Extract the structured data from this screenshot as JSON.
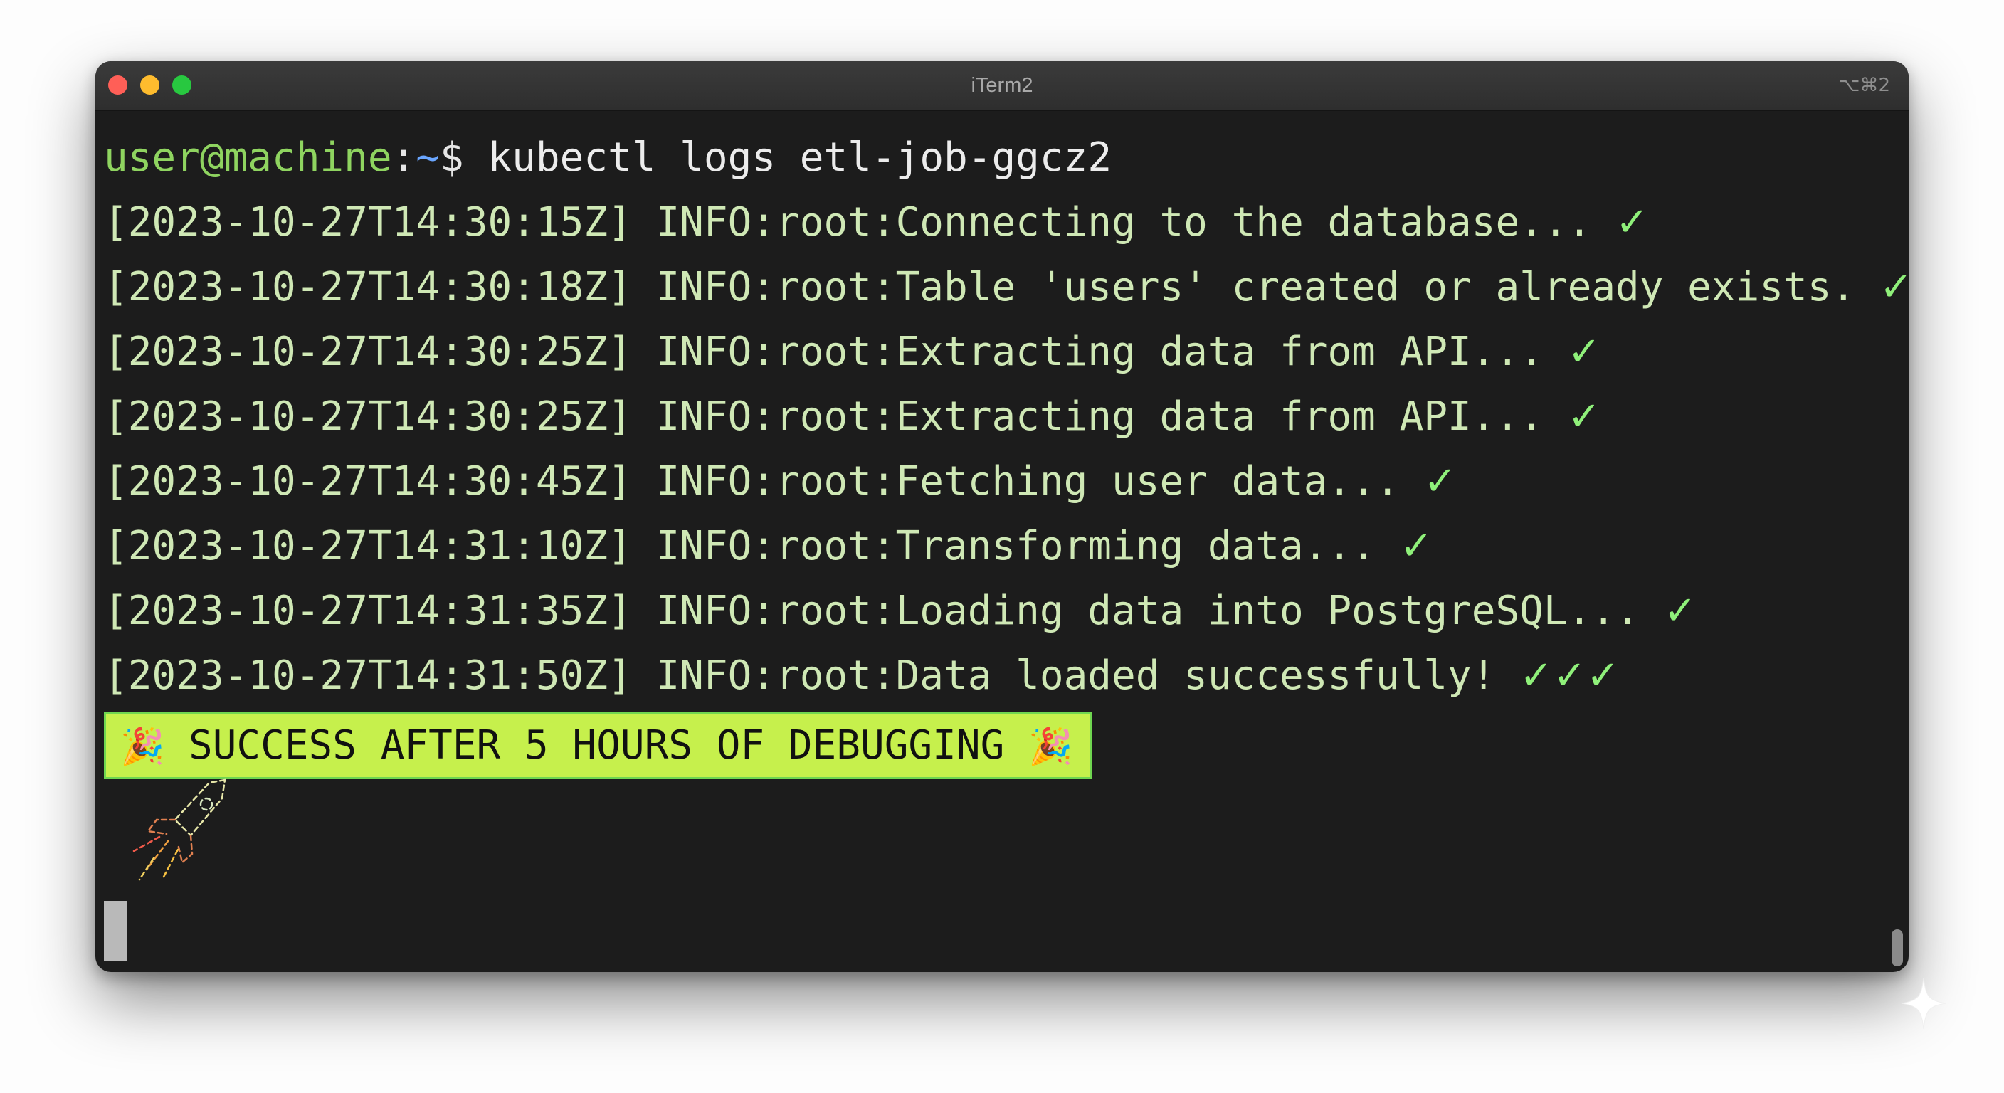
{
  "window": {
    "title": "iTerm2",
    "shortcut": "⌥⌘2"
  },
  "prompt": {
    "user_host": "user@machine",
    "separator": ":",
    "path": "~",
    "symbol": "$ ",
    "command": "kubectl logs etl-job-ggcz2"
  },
  "logs": [
    {
      "text": "[2023-10-27T14:30:15Z] INFO:root:Connecting to the database... ",
      "check": "✓"
    },
    {
      "text": "[2023-10-27T14:30:18Z] INFO:root:Table 'users' created or already exists. ",
      "check": "✓"
    },
    {
      "text": "[2023-10-27T14:30:25Z] INFO:root:Extracting data from API... ",
      "check": "✓"
    },
    {
      "text": "[2023-10-27T14:30:25Z] INFO:root:Extracting data from API... ",
      "check": "✓"
    },
    {
      "text": "[2023-10-27T14:30:45Z] INFO:root:Fetching user data... ",
      "check": "✓"
    },
    {
      "text": "[2023-10-27T14:31:10Z] INFO:root:Transforming data... ",
      "check": "✓"
    },
    {
      "text": "[2023-10-27T14:31:35Z] INFO:root:Loading data into PostgreSQL... ",
      "check": "✓"
    },
    {
      "text": "[2023-10-27T14:31:50Z] INFO:root:Data loaded successfully! ",
      "check": "✓✓✓"
    }
  ],
  "banner": {
    "emoji_left": "🎉",
    "text": " SUCCESS AFTER 5 HOURS OF DEBUGGING ",
    "emoji_right": "🎉"
  },
  "icons": {
    "rocket": "rocket-icon",
    "cursor": "block-cursor",
    "sparkle": "sparkle-icon"
  },
  "colors": {
    "terminal_bg": "#1c1c1c",
    "log_text": "#cfe8b5",
    "prompt_user": "#8fd460",
    "prompt_path": "#6aa6ff",
    "check": "#8ff07a",
    "banner_bg": "#c6f04c"
  }
}
